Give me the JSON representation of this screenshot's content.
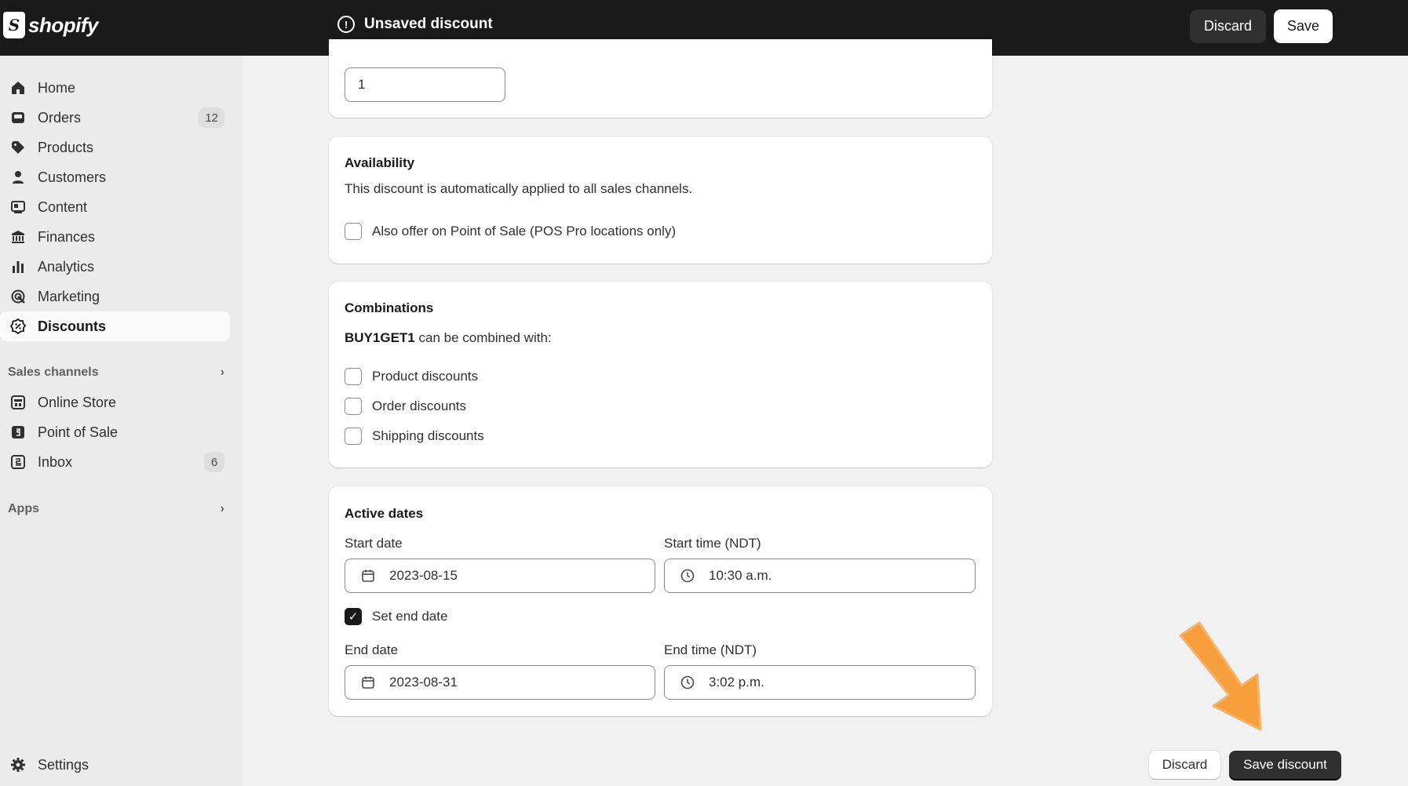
{
  "topbar": {
    "logo_text": "shopify",
    "logo_mark": "S",
    "status": "Unsaved discount",
    "status_icon": "alert-circle-icon",
    "discard_label": "Discard",
    "save_label": "Save"
  },
  "sidebar": {
    "items": [
      {
        "label": "Home",
        "icon": "home-icon"
      },
      {
        "label": "Orders",
        "icon": "orders-icon",
        "badge": "12"
      },
      {
        "label": "Products",
        "icon": "tag-icon"
      },
      {
        "label": "Customers",
        "icon": "person-icon"
      },
      {
        "label": "Content",
        "icon": "content-icon"
      },
      {
        "label": "Finances",
        "icon": "bank-icon"
      },
      {
        "label": "Analytics",
        "icon": "bar-chart-icon"
      },
      {
        "label": "Marketing",
        "icon": "target-icon"
      },
      {
        "label": "Discounts",
        "icon": "discount-icon"
      }
    ],
    "sales_channels_label": "Sales channels",
    "channels": [
      {
        "label": "Online Store",
        "icon": "store-icon"
      },
      {
        "label": "Point of Sale",
        "icon": "pos-icon"
      },
      {
        "label": "Inbox",
        "icon": "inbox-icon",
        "badge": "6"
      }
    ],
    "apps_label": "Apps",
    "settings_label": "Settings"
  },
  "top_card": {
    "input_value": "1"
  },
  "availability": {
    "title": "Availability",
    "description": "This discount is automatically applied to all sales channels.",
    "pos_checkbox_label": "Also offer on Point of Sale (POS Pro locations only)",
    "pos_checked": false
  },
  "combinations": {
    "title": "Combinations",
    "code": "BUY1GET1",
    "description_suffix": "can be combined with:",
    "options": [
      {
        "label": "Product discounts",
        "checked": false
      },
      {
        "label": "Order discounts",
        "checked": false
      },
      {
        "label": "Shipping discounts",
        "checked": false
      }
    ]
  },
  "active_dates": {
    "title": "Active dates",
    "start_date_label": "Start date",
    "start_date_value": "2023-08-15",
    "start_time_label": "Start time (NDT)",
    "start_time_value": "10:30 a.m.",
    "set_end_label": "Set end date",
    "set_end_checked": true,
    "end_date_label": "End date",
    "end_date_value": "2023-08-31",
    "end_time_label": "End time (NDT)",
    "end_time_value": "3:02 p.m."
  },
  "footer": {
    "discard_label": "Discard",
    "save_label": "Save discount"
  },
  "colors": {
    "topbar": "#1a1a1a",
    "arrow": "#f59e3b"
  }
}
